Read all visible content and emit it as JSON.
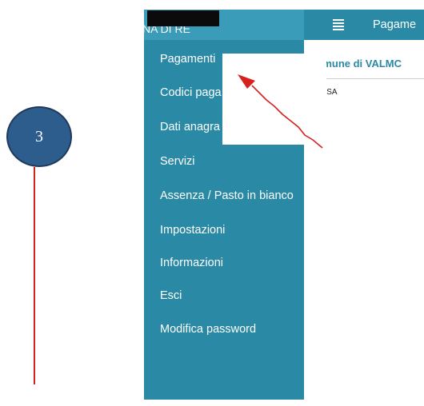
{
  "step": {
    "number": "3"
  },
  "drawer": {
    "header_text": "NA DI RE",
    "items": [
      {
        "label": "Pagamenti"
      },
      {
        "label": "Codici paga"
      },
      {
        "label": "Dati anagra"
      },
      {
        "label": "Servizi"
      },
      {
        "label": "Assenza / Pasto in bianco"
      },
      {
        "label": "Impostazioni"
      },
      {
        "label": "Informazioni"
      },
      {
        "label": "Esci"
      },
      {
        "label": "Modifica password"
      }
    ]
  },
  "appbar": {
    "title": "Pagame"
  },
  "content": {
    "comune": "Comune di VALMC",
    "item": "MENSA"
  },
  "colors": {
    "drawer": "#2a8aa5",
    "step_circle": "#2d5d8c",
    "callout_line": "#d6211f"
  }
}
